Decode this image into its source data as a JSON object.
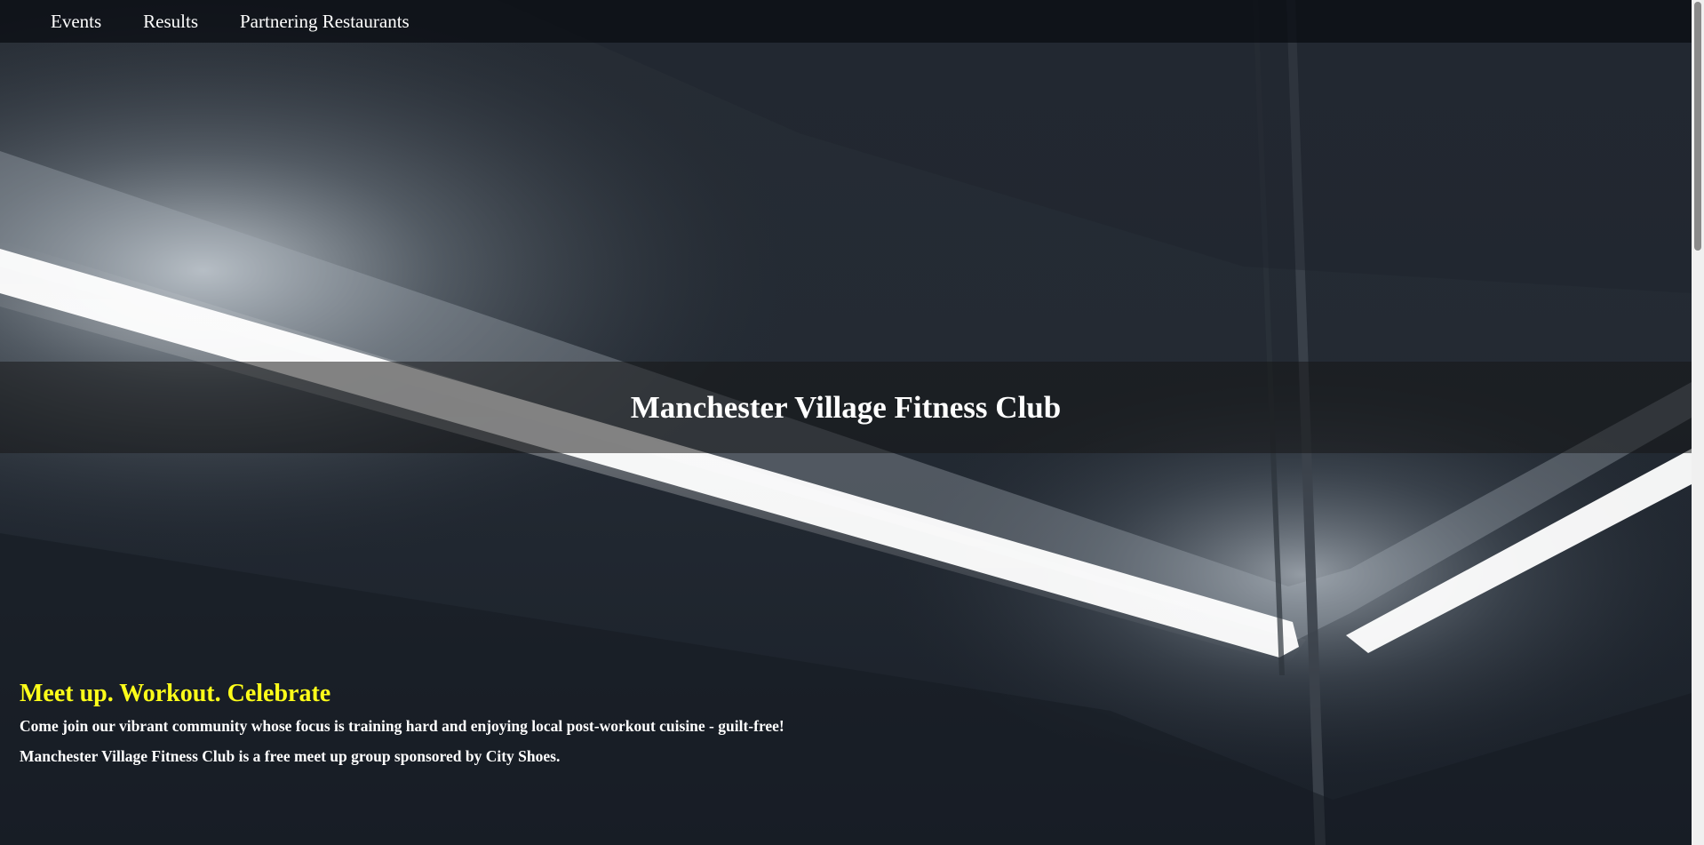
{
  "nav": {
    "items": [
      {
        "label": "Events"
      },
      {
        "label": "Results"
      },
      {
        "label": "Partnering Restaurants"
      }
    ]
  },
  "hero": {
    "title": "Manchester Village Fitness Club"
  },
  "intro": {
    "tagline": "Meet up. Workout. Celebrate",
    "paragraphs": [
      "Come join our vibrant community whose focus is training hard and enjoying local post-workout cuisine - guilt-free!",
      "Manchester Village Fitness Club is a free meet up group sponsored by City Shoes."
    ]
  },
  "colors": {
    "tagline": "#ffff1a",
    "text": "#ffffff",
    "background": "#1b222b"
  }
}
